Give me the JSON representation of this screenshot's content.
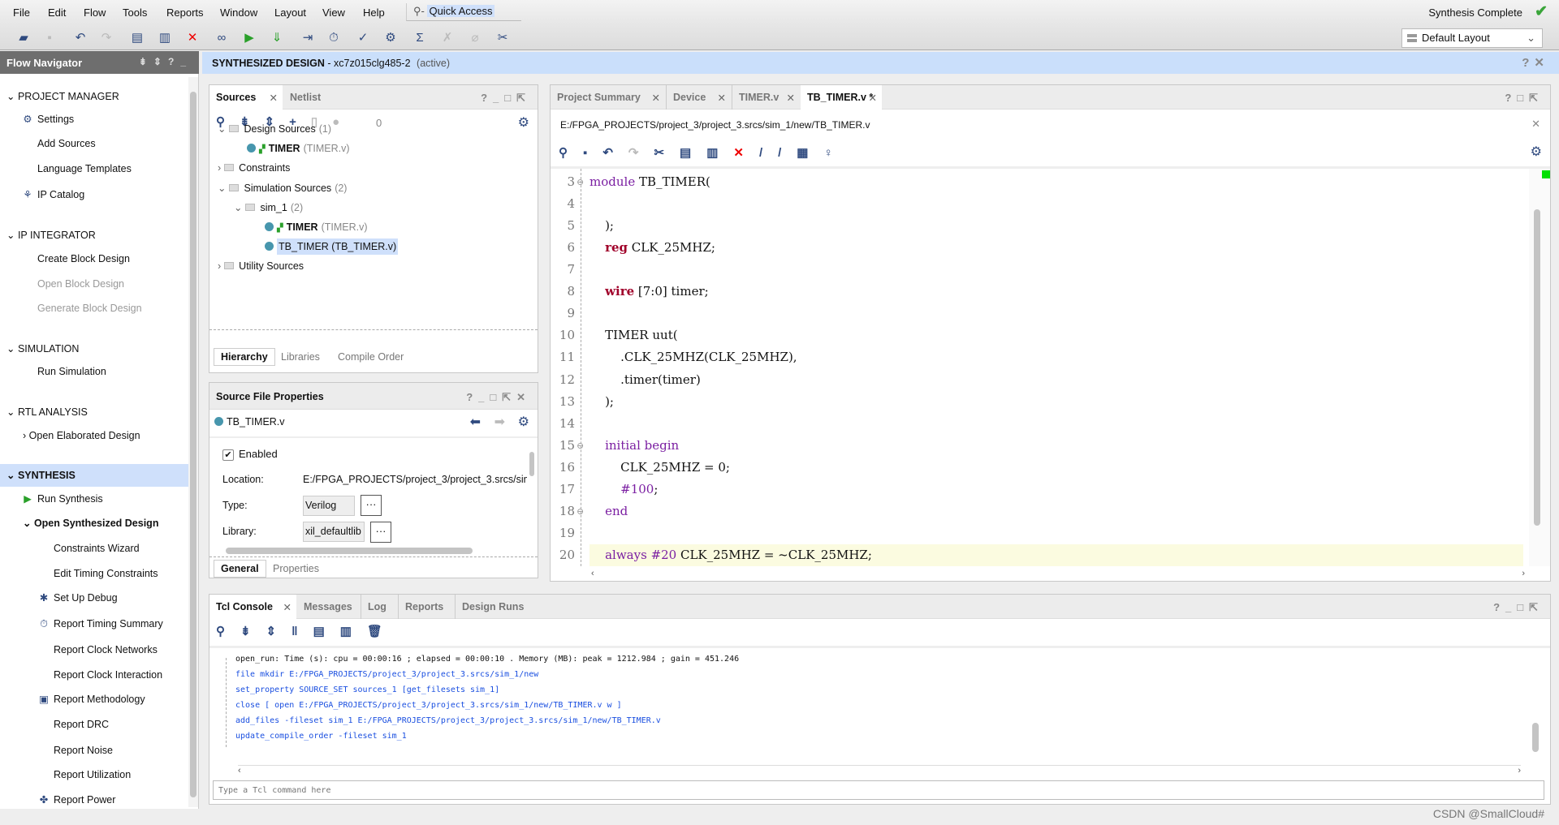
{
  "menu": [
    "File",
    "Edit",
    "Flow",
    "Tools",
    "Reports",
    "Window",
    "Layout",
    "View",
    "Help"
  ],
  "quick_access": "Quick Access",
  "status": "Synthesis Complete",
  "layout_select": "Default Layout",
  "toolbar_icons": [
    "open-project-icon",
    "save-icon",
    "undo-icon",
    "redo-icon",
    "copy-icon",
    "paste-icon",
    "delete-icon",
    "binoculars-icon",
    "run-icon",
    "program-device-icon",
    "step-icon",
    "timer-icon",
    "clipboard-check-icon",
    "gear-icon",
    "sigma-icon",
    "disabled-tool-icon",
    "disabled-wand-icon",
    "cross-tools-icon"
  ],
  "flow_navigator": {
    "title": "Flow Navigator",
    "items": [
      {
        "label": "PROJECT MANAGER",
        "kind": "section"
      },
      {
        "label": "Settings",
        "icon": "gear-icon"
      },
      {
        "label": "Add Sources"
      },
      {
        "label": "Language Templates"
      },
      {
        "label": "IP Catalog",
        "icon": "ip-icon"
      },
      {
        "label": "IP INTEGRATOR",
        "kind": "section"
      },
      {
        "label": "Create Block Design"
      },
      {
        "label": "Open Block Design",
        "disabled": true
      },
      {
        "label": "Generate Block Design",
        "disabled": true
      },
      {
        "label": "SIMULATION",
        "kind": "section"
      },
      {
        "label": "Run Simulation"
      },
      {
        "label": "RTL ANALYSIS",
        "kind": "section"
      },
      {
        "label": "Open Elaborated Design",
        "kind": "sub-collapsed"
      },
      {
        "label": "SYNTHESIS",
        "kind": "section",
        "active": true
      },
      {
        "label": "Run Synthesis",
        "icon": "run-icon"
      },
      {
        "label": "Open Synthesized Design",
        "kind": "sub-expanded"
      },
      {
        "label": "Constraints Wizard"
      },
      {
        "label": "Edit Timing Constraints"
      },
      {
        "label": "Set Up Debug",
        "icon": "debug-icon"
      },
      {
        "label": "Report Timing Summary",
        "icon": "timer-icon"
      },
      {
        "label": "Report Clock Networks"
      },
      {
        "label": "Report Clock Interaction"
      },
      {
        "label": "Report Methodology",
        "icon": "clipboard-icon"
      },
      {
        "label": "Report DRC"
      },
      {
        "label": "Report Noise"
      },
      {
        "label": "Report Utilization"
      },
      {
        "label": "Report Power",
        "icon": "power-icon"
      }
    ]
  },
  "banner": {
    "title": "SYNTHESIZED DESIGN",
    "part": " - xc7z015clg485-2",
    "state": "(active)"
  },
  "sources": {
    "tabs": [
      "Sources",
      "Netlist"
    ],
    "count": "0",
    "tree": [
      {
        "label": "Design Sources",
        "extra": "(1)",
        "type": "folder",
        "open": true,
        "level": 0
      },
      {
        "label": "TIMER",
        "extra": "(TIMER.v)",
        "type": "module",
        "level": 1
      },
      {
        "label": "Constraints",
        "type": "folder",
        "open": false,
        "level": 0
      },
      {
        "label": "Simulation Sources",
        "extra": "(2)",
        "type": "folder",
        "open": true,
        "level": 0
      },
      {
        "label": "sim_1",
        "extra": "(2)",
        "type": "folder",
        "open": true,
        "level": 1
      },
      {
        "label": "TIMER",
        "extra": "(TIMER.v)",
        "type": "module",
        "level": 2
      },
      {
        "label": "TB_TIMER (TB_TIMER.v)",
        "type": "file",
        "level": 2,
        "selected": true
      },
      {
        "label": "Utility Sources",
        "type": "folder",
        "open": false,
        "level": 0
      }
    ],
    "bottom_tabs": [
      "Hierarchy",
      "Libraries",
      "Compile Order"
    ]
  },
  "props": {
    "title": "Source File Properties",
    "file": "TB_TIMER.v",
    "enabled_label": "Enabled",
    "enabled": true,
    "location_label": "Location:",
    "location": "E:/FPGA_PROJECTS/project_3/project_3.srcs/sim",
    "type_label": "Type:",
    "type": "Verilog",
    "library_label": "Library:",
    "library": "xil_defaultlib",
    "more": "···",
    "bottom_tabs": [
      "General",
      "Properties"
    ]
  },
  "editor": {
    "tabs": [
      "Project Summary",
      "Device",
      "TIMER.v",
      "TB_TIMER.v *"
    ],
    "path": "E:/FPGA_PROJECTS/project_3/project_3.srcs/sim_1/new/TB_TIMER.v",
    "lines": [
      {
        "n": "3",
        "fold": true,
        "t": [
          [
            "module",
            "kw"
          ],
          [
            " TB_TIMER(",
            ""
          ]
        ]
      },
      {
        "n": "4",
        "t": []
      },
      {
        "n": "5",
        "t": [
          [
            "    );",
            ""
          ]
        ]
      },
      {
        "n": "6",
        "t": [
          [
            "    ",
            ""
          ],
          [
            "reg",
            "kb"
          ],
          [
            " CLK_25MHZ;",
            ""
          ]
        ]
      },
      {
        "n": "7",
        "t": []
      },
      {
        "n": "8",
        "t": [
          [
            "    ",
            ""
          ],
          [
            "wire",
            "kb"
          ],
          [
            " [7:0] timer;",
            ""
          ]
        ]
      },
      {
        "n": "9",
        "t": []
      },
      {
        "n": "10",
        "t": [
          [
            "    TIMER uut(",
            ""
          ]
        ]
      },
      {
        "n": "11",
        "t": [
          [
            "        .CLK_25MHZ(CLK_25MHZ),",
            ""
          ]
        ]
      },
      {
        "n": "12",
        "t": [
          [
            "        .timer(timer)",
            ""
          ]
        ]
      },
      {
        "n": "13",
        "t": [
          [
            "    );",
            ""
          ]
        ]
      },
      {
        "n": "14",
        "t": []
      },
      {
        "n": "15",
        "fold": true,
        "t": [
          [
            "    ",
            ""
          ],
          [
            "initial begin",
            "kw"
          ]
        ]
      },
      {
        "n": "16",
        "t": [
          [
            "        CLK_25MHZ = 0;",
            ""
          ]
        ]
      },
      {
        "n": "17",
        "t": [
          [
            "        ",
            ""
          ],
          [
            "#100",
            "num"
          ],
          [
            ";",
            ""
          ]
        ]
      },
      {
        "n": "18",
        "fold": true,
        "t": [
          [
            "    ",
            ""
          ],
          [
            "end",
            "kw"
          ]
        ]
      },
      {
        "n": "19",
        "t": []
      },
      {
        "n": "20",
        "current": true,
        "t": [
          [
            "    ",
            ""
          ],
          [
            "always",
            "kw"
          ],
          [
            " ",
            ""
          ],
          [
            "#20",
            "num"
          ],
          [
            " CLK_25MHZ = ~CLK_25MHZ;",
            ""
          ]
        ]
      }
    ]
  },
  "console": {
    "tabs": [
      "Tcl Console",
      "Messages",
      "Log",
      "Reports",
      "Design Runs"
    ],
    "lines": [
      {
        "text": "open_run: Time (s): cpu = 00:00:16 ; elapsed = 00:00:10 . Memory (MB): peak = 1212.984 ; gain = 451.246",
        "color": "#111111"
      },
      {
        "text": "file mkdir E:/FPGA_PROJECTS/project_3/project_3.srcs/sim_1/new",
        "color": "#1a4fe0"
      },
      {
        "text": "set_property SOURCE_SET sources_1 [get_filesets sim_1]",
        "color": "#1a4fe0"
      },
      {
        "text": "close [ open E:/FPGA_PROJECTS/project_3/project_3.srcs/sim_1/new/TB_TIMER.v w ]",
        "color": "#1a4fe0"
      },
      {
        "text": "add_files -fileset sim_1 E:/FPGA_PROJECTS/project_3/project_3.srcs/sim_1/new/TB_TIMER.v",
        "color": "#1a4fe0"
      },
      {
        "text": "update_compile_order -fileset sim_1",
        "color": "#1a4fe0"
      }
    ],
    "placeholder": "Type a Tcl command here"
  },
  "watermark": "CSDN @SmallCloud#"
}
